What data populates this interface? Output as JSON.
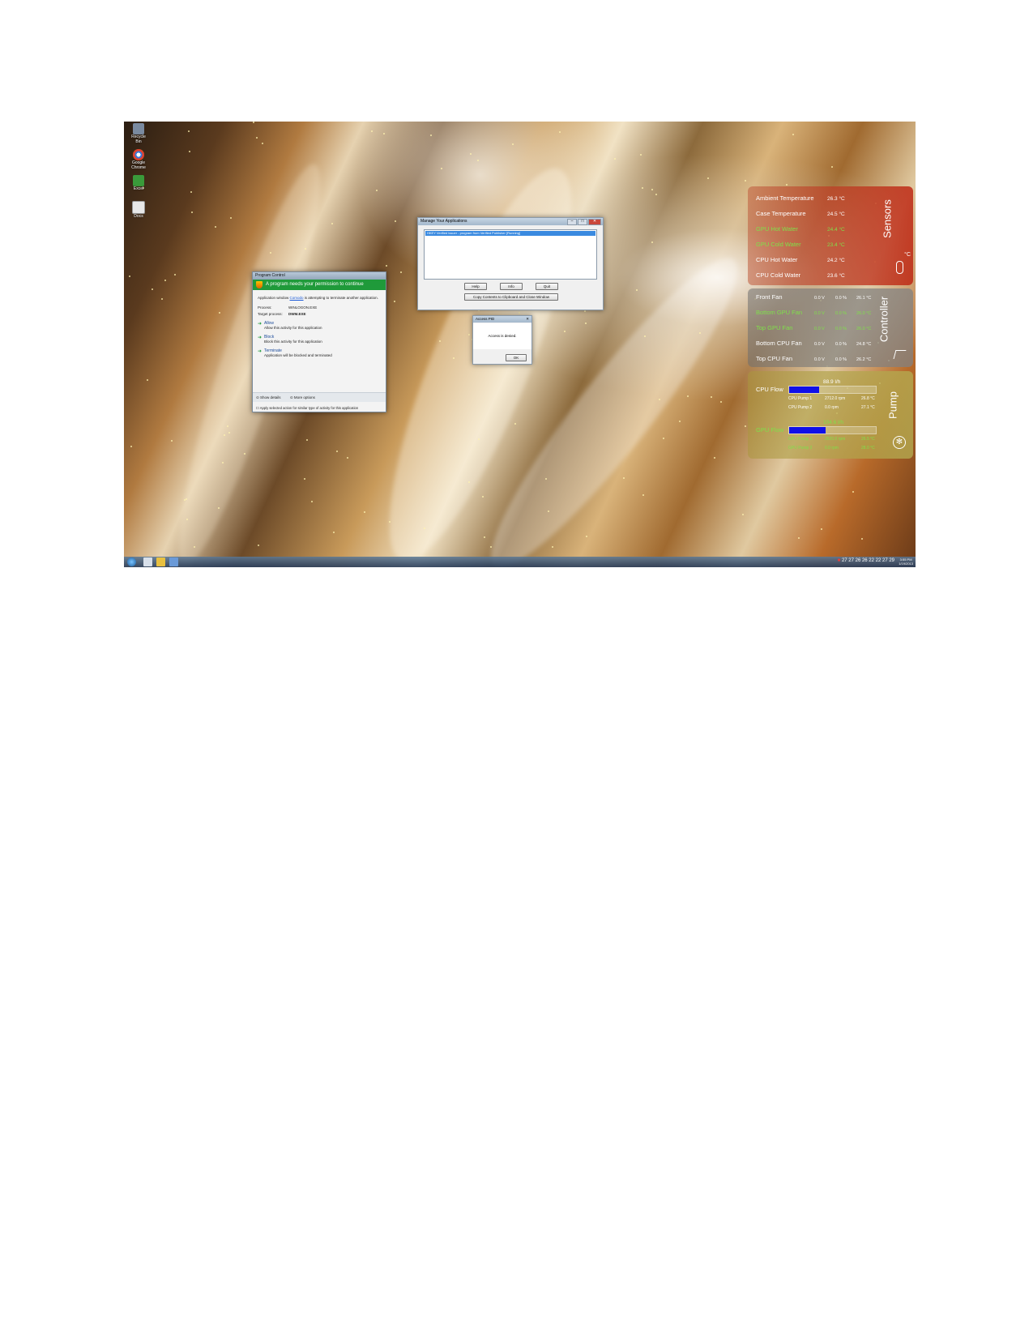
{
  "desktop_icons": [
    {
      "label": "Recycle Bin",
      "icon": "recycle-bin-icon",
      "color": "#7a8aa0"
    },
    {
      "label": "Google Chrome",
      "icon": "chrome-icon",
      "color": "#3a7ad8"
    },
    {
      "label": "Excel",
      "icon": "excel-icon",
      "color": "#3a9a3a"
    },
    {
      "label": "Docs",
      "icon": "document-icon",
      "color": "#e8e8e8"
    }
  ],
  "uac": {
    "title": "Program Control",
    "banner": "A program needs your permission to continue",
    "description_pre": "Application window ",
    "description_link": "Comodo",
    "description_post": " is attempting to terminate another application.",
    "rows": [
      {
        "label": "Process:",
        "value": "WINLOGON.EXE"
      },
      {
        "label": "Target process:",
        "value": "DWM.EXE"
      }
    ],
    "options": [
      {
        "title": "Allow",
        "desc": "Allow this activity for this application"
      },
      {
        "title": "Block",
        "desc": "Block this activity for this application"
      },
      {
        "title": "Terminate",
        "desc": "Application will be blocked and terminated"
      }
    ],
    "footer": {
      "details": "Show details",
      "more": "More options"
    },
    "checkbox": "Apply selected action for similar type of activity for this application"
  },
  "manage": {
    "title": "Manage Your Applications",
    "selected_item": "HKEY Verified issuer - program from Verified Publisher [Running]",
    "buttons": {
      "help": "Help",
      "info": "Info",
      "quit": "Quit"
    },
    "copy_button": "Copy Contents to Clipboard and Close Window"
  },
  "denied": {
    "title": "Access PID",
    "message": "Access is denied.",
    "ok": "OK"
  },
  "sensors": {
    "title": "Sensors",
    "unit": "°C",
    "rows": [
      {
        "name": "Ambient Temperature",
        "value": "26.3 °C",
        "highlight": false
      },
      {
        "name": "Case Temperature",
        "value": "24.5 °C",
        "highlight": false
      },
      {
        "name": "GPU Hot Water",
        "value": "24.4 °C",
        "highlight": true
      },
      {
        "name": "GPU Cold Water",
        "value": "23.4 °C",
        "highlight": true
      },
      {
        "name": "CPU Hot Water",
        "value": "24.2 °C",
        "highlight": false
      },
      {
        "name": "CPU Cold Water",
        "value": "23.6 °C",
        "highlight": false
      }
    ]
  },
  "controller": {
    "title": "Controller",
    "rows": [
      {
        "name": "Front Fan",
        "volt": "0.0 V",
        "pct": "0.0 %",
        "temp": "26.1 °C",
        "highlight": false
      },
      {
        "name": "Bottom GPU Fan",
        "volt": "0.0 V",
        "pct": "0.0 %",
        "temp": "26.0 °C",
        "highlight": true
      },
      {
        "name": "Top GPU Fan",
        "volt": "0.0 V",
        "pct": "0.0 %",
        "temp": "26.0 °C",
        "highlight": true
      },
      {
        "name": "Bottom CPU Fan",
        "volt": "0.0 V",
        "pct": "0.0 %",
        "temp": "24.8 °C",
        "highlight": false
      },
      {
        "name": "Top CPU Fan",
        "volt": "0.0 V",
        "pct": "0.0 %",
        "temp": "26.2 °C",
        "highlight": false
      }
    ]
  },
  "pump": {
    "title": "Pump",
    "cpu": {
      "label": "CPU Flow",
      "flow": "88.9 l/h",
      "fill": 0.35,
      "pumps": [
        {
          "name": "CPU Pump 1",
          "rpm": "2712.0 rpm",
          "temp": "26.8 °C"
        },
        {
          "name": "CPU Pump 2",
          "rpm": "0.0 rpm",
          "temp": "27.1 °C"
        }
      ]
    },
    "gpu": {
      "label": "GPU Flow",
      "flow": "104.6 l/h",
      "fill": 0.42,
      "pumps": [
        {
          "name": "GPU Pump 1",
          "rpm": "2520.0 rpm",
          "temp": "26.5 °C"
        },
        {
          "name": "GPU Pump 2",
          "rpm": "0.0 rpm",
          "temp": "28.0 °C"
        }
      ]
    }
  },
  "taskbar": {
    "tray_text": "27 27 26 26 22 22 27 29",
    "time": "3:55 PM",
    "date": "1/19/2013"
  }
}
